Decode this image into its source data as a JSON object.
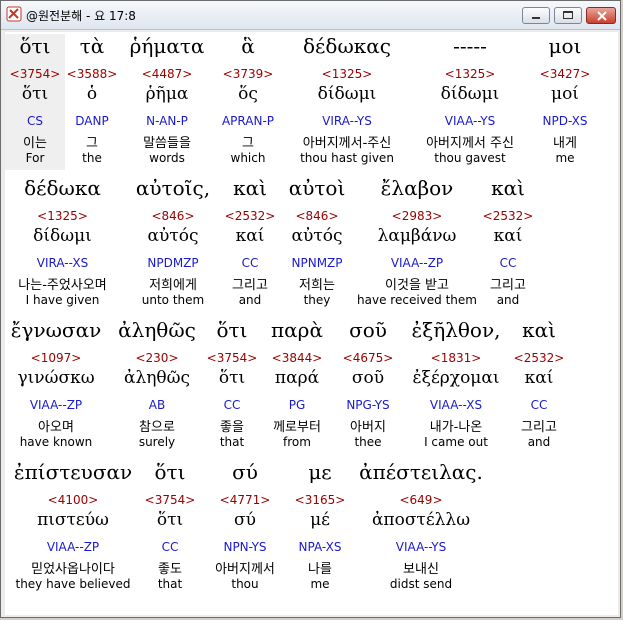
{
  "window": {
    "title": "@원전분해 - 요 17:8"
  },
  "rows": [
    {
      "words": [
        {
          "greek": "ὅτι",
          "strong": "<3754>",
          "lemma": "ὅτι",
          "parse": "CS",
          "korean": "이는",
          "english": "For",
          "selected": true
        },
        {
          "greek": "τὰ",
          "strong": "<3588>",
          "lemma": "ὁ",
          "parse": "DANP",
          "korean": "그",
          "english": "the"
        },
        {
          "greek": "ῥήματα",
          "strong": "<4487>",
          "lemma": "ῥῆμα",
          "parse": "N-AN-P",
          "korean": "말씀들을",
          "english": "words"
        },
        {
          "greek": "ἃ",
          "strong": "<3739>",
          "lemma": "ὅς",
          "parse": "APRAN-P",
          "korean": "그",
          "english": "which"
        },
        {
          "greek": "δέδωκας",
          "strong": "<1325>",
          "lemma": "δίδωμι",
          "parse": "VIRA--YS",
          "korean": "아버지께서-주신",
          "english": "thou hast given"
        },
        {
          "greek": "-----",
          "strong": "<1325>",
          "lemma": "δίδωμι",
          "parse": "VIAA--YS",
          "korean": "아버지께서 주신",
          "english": "thou gavest"
        },
        {
          "greek": "μοι",
          "strong": "<3427>",
          "lemma": "μοί",
          "parse": "NPD-XS",
          "korean": "내게",
          "english": "me"
        }
      ]
    },
    {
      "words": [
        {
          "greek": "δέδωκα",
          "strong": "<1325>",
          "lemma": "δίδωμι",
          "parse": "VIRA--XS",
          "korean": "나는-주었사오며",
          "english": "I have given"
        },
        {
          "greek": "αὐτοῖς,",
          "strong": "<846>",
          "lemma": "αὐτός",
          "parse": "NPDMZP",
          "korean": "저희에게",
          "english": "unto them"
        },
        {
          "greek": "καὶ",
          "strong": "<2532>",
          "lemma": "καί",
          "parse": "CC",
          "korean": "그리고",
          "english": "and"
        },
        {
          "greek": "αὐτοὶ",
          "strong": "<846>",
          "lemma": "αὐτός",
          "parse": "NPNMZP",
          "korean": "저희는",
          "english": "they"
        },
        {
          "greek": "ἔλαβον",
          "strong": "<2983>",
          "lemma": "λαμβάνω",
          "parse": "VIAA--ZP",
          "korean": "이것을 받고",
          "english": "have received them"
        },
        {
          "greek": "καὶ",
          "strong": "<2532>",
          "lemma": "καί",
          "parse": "CC",
          "korean": "그리고",
          "english": "and"
        }
      ]
    },
    {
      "words": [
        {
          "greek": "ἔγνωσαν",
          "strong": "<1097>",
          "lemma": "γινώσκω",
          "parse": "VIAA--ZP",
          "korean": "아오며",
          "english": "have known"
        },
        {
          "greek": "ἀληθῶς",
          "strong": "<230>",
          "lemma": "ἀληθῶς",
          "parse": "AB",
          "korean": "참으로",
          "english": "surely"
        },
        {
          "greek": "ὅτι",
          "strong": "<3754>",
          "lemma": "ὅτι",
          "parse": "CC",
          "korean": "좋을",
          "english": "that"
        },
        {
          "greek": "παρὰ",
          "strong": "<3844>",
          "lemma": "παρά",
          "parse": "PG",
          "korean": "께로부터",
          "english": "from"
        },
        {
          "greek": "σοῦ",
          "strong": "<4675>",
          "lemma": "σοῦ",
          "parse": "NPG-YS",
          "korean": "아버지",
          "english": "thee"
        },
        {
          "greek": "ἐξῆλθον,",
          "strong": "<1831>",
          "lemma": "ἐξέρχομαι",
          "parse": "VIAA--XS",
          "korean": "내가-나온",
          "english": "I came out"
        },
        {
          "greek": "καὶ",
          "strong": "<2532>",
          "lemma": "καί",
          "parse": "CC",
          "korean": "그리고",
          "english": "and"
        }
      ]
    },
    {
      "words": [
        {
          "greek": "ἐπίστευσαν",
          "strong": "<4100>",
          "lemma": "πιστεύω",
          "parse": "VIAA--ZP",
          "korean": "믿었사옵나이다",
          "english": "they have believed"
        },
        {
          "greek": "ὅτι",
          "strong": "<3754>",
          "lemma": "ὅτι",
          "parse": "CC",
          "korean": "좋도",
          "english": "that"
        },
        {
          "greek": "σύ",
          "strong": "<4771>",
          "lemma": "σύ",
          "parse": "NPN-YS",
          "korean": "아버지께서",
          "english": "thou"
        },
        {
          "greek": "με",
          "strong": "<3165>",
          "lemma": "μέ",
          "parse": "NPA-XS",
          "korean": "나를",
          "english": "me"
        },
        {
          "greek": "ἀπέστειλας.",
          "strong": "<649>",
          "lemma": "ἀποστέλλω",
          "parse": "VIAA--YS",
          "korean": "보내신",
          "english": "didst send"
        }
      ]
    }
  ]
}
